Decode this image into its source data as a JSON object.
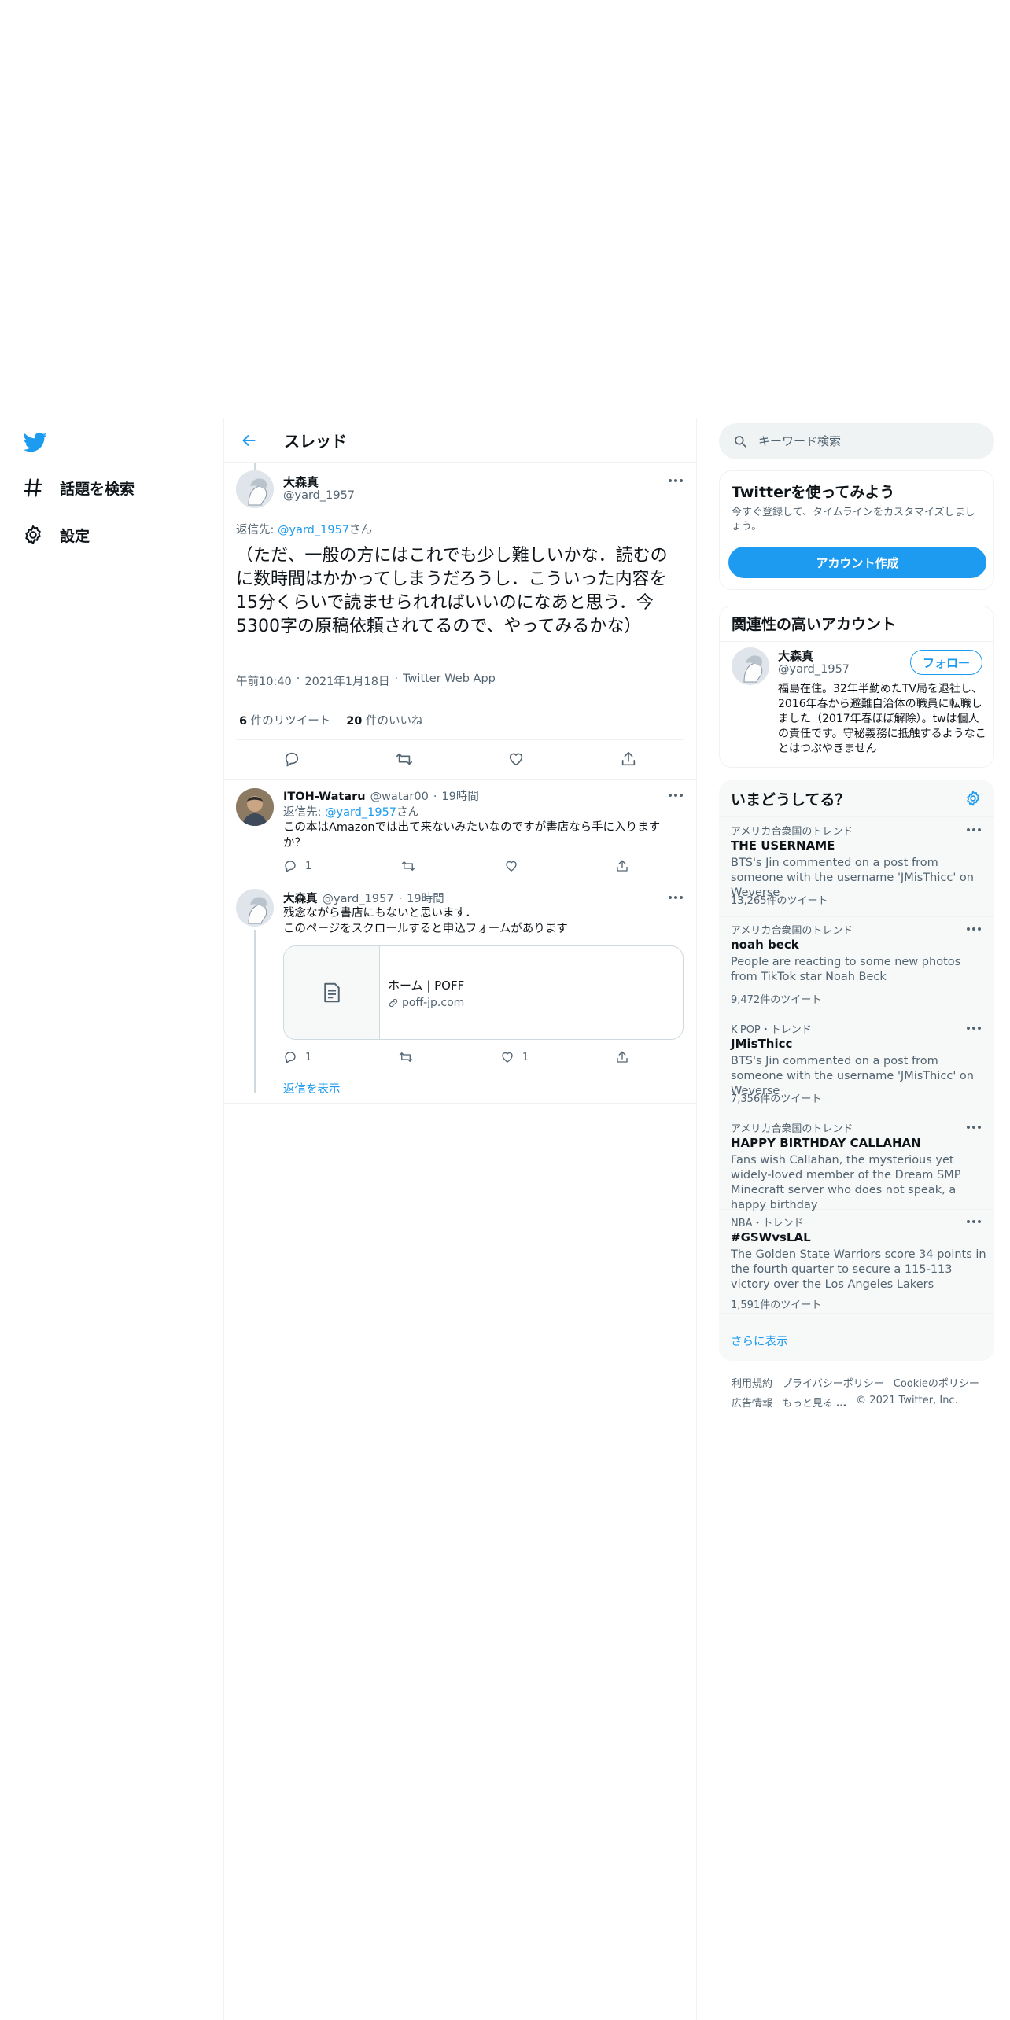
{
  "nav": {
    "logo_icon": "twitter-bird-icon",
    "brand_color": "#1d9bf0",
    "items": [
      {
        "icon": "hashtag-icon",
        "label": "話題を検索"
      },
      {
        "icon": "gear-icon",
        "label": "設定"
      }
    ]
  },
  "main": {
    "header_title": "スレッド",
    "focus_tweet": {
      "name": "大森真",
      "handle": "@yard_1957",
      "reply_prefix": "返信先: ",
      "reply_handle": "@yard_1957",
      "reply_suffix": "さん",
      "text": "（ただ、一般の方にはこれでも少し難しいかな．読むのに数時間はかかってしまうだろうし．こういった内容を15分くらいで読ませられればいいのになあと思う．今5300字の原稿依頼されてるので、やってみるかな）",
      "time": "午前10:40",
      "date": "2021年1月18日",
      "source": "Twitter Web App",
      "retweets_count": "6",
      "retweets_label": " 件のリツイート",
      "likes_count": "20",
      "likes_label": " 件のいいね"
    },
    "replies": [
      {
        "name": "ITOH-Wataru",
        "handle": "@watar00",
        "time": "19時間",
        "reply_prefix": "返信先: ",
        "reply_handle": "@yard_1957",
        "reply_suffix": "さん",
        "text": "この本はAmazonでは出て来ないみたいなのですが書店なら手に入りますか？",
        "reply_count": "1",
        "like_count": ""
      },
      {
        "name": "大森真",
        "handle": "@yard_1957",
        "time": "19時間",
        "text_line1": "残念ながら書店にもないと思います．",
        "text_line2": "このページをスクロールすると申込フォームがあります",
        "card_title": "ホーム | POFF",
        "card_domain": "poff-jp.com",
        "reply_count": "1",
        "like_count": "1",
        "show_replies": "返信を表示"
      }
    ]
  },
  "sidebar": {
    "search_placeholder": "キーワード検索",
    "signup": {
      "title": "Twitterを使ってみよう",
      "subtitle": "今すぐ登録して、タイムラインをカスタマイズしましょう。",
      "button": "アカウント作成"
    },
    "relevant": {
      "title": "関連性の高いアカウント",
      "name": "大森真",
      "handle": "@yard_1957",
      "follow": "フォロー",
      "bio": "福島在住。32年半勤めたTV局を退社し、2016年春から避難自治体の職員に転職しました（2017年春ほぼ解除）。twは個人の責任です。守秘義務に抵触するようなことはつぶやきません"
    },
    "trends": {
      "title": "いまどうしてる？",
      "items": [
        {
          "meta": "アメリカ合衆国のトレンド",
          "name": "THE USERNAME",
          "desc": "BTS's Jin commented on a post from someone with the username 'JMisThicc' on Weverse",
          "count": "13,265件のツイート"
        },
        {
          "meta": "アメリカ合衆国のトレンド",
          "name": "noah beck",
          "desc": "People are reacting to some new photos from TikTok star Noah Beck",
          "count": "9,472件のツイート"
        },
        {
          "meta": "K-POP・トレンド",
          "name": "JMisThicc",
          "desc": "BTS's Jin commented on a post from someone with the username 'JMisThicc' on Weverse",
          "count": "7,356件のツイート"
        },
        {
          "meta": "アメリカ合衆国のトレンド",
          "name": "HAPPY BIRTHDAY CALLAHAN",
          "desc": "Fans wish Callahan, the mysterious yet widely-loved member of the Dream SMP Minecraft server who does not speak, a happy birthday",
          "count": ""
        },
        {
          "meta": "NBA・トレンド",
          "name": "#GSWvsLAL",
          "desc": "The Golden State Warriors score 34 points in the fourth quarter to secure a 115-113 victory over the Los Angeles Lakers",
          "count": "1,591件のツイート"
        }
      ],
      "show_more": "さらに表示"
    },
    "footer": {
      "terms": "利用規約",
      "privacy": "プライバシーポリシー",
      "cookies": "Cookieのポリシー",
      "ads": "広告情報",
      "more": "もっと見る",
      "copyright": "© 2021 Twitter, Inc."
    }
  }
}
